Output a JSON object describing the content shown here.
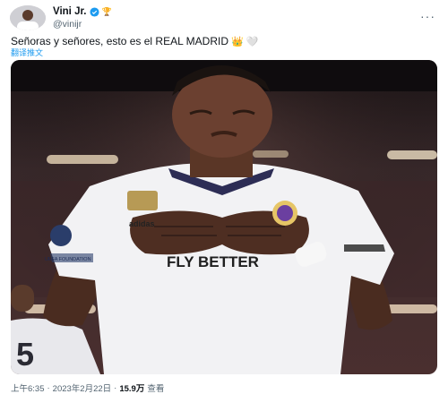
{
  "author": {
    "display_name": "Vini Jr.",
    "handle": "@vinijr"
  },
  "tweet": {
    "text": "Señoras y señores, esto es el REAL MADRID",
    "emojis": [
      "👑",
      "🤍"
    ],
    "translate_label": "翻译推文"
  },
  "media": {
    "jersey_text": "FLY BETTER",
    "patch_text": "UEFA FOUNDATION",
    "sponsor": "adidas"
  },
  "meta": {
    "time": "上午6:35",
    "separator": "·",
    "date": "2023年2月22日",
    "views_count": "15.9万",
    "views_label": "查看"
  },
  "colors": {
    "accent": "#1d9bf0",
    "text": "#0f1419",
    "secondary": "#536471",
    "jersey": "#f2f2f4",
    "stadium": "#2a1f24"
  }
}
